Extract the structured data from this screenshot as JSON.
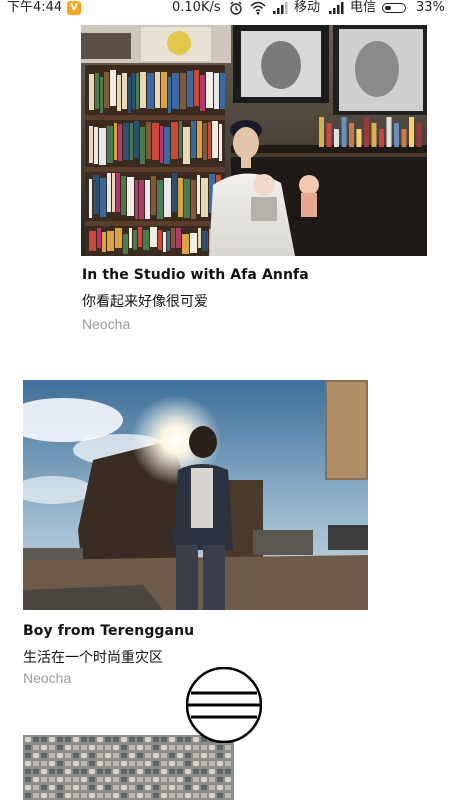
{
  "status_bar": {
    "time": "下午4:44",
    "notification_badge": "V",
    "network_speed": "0.10K/s",
    "carrier_1": "移动",
    "carrier_2": "电信",
    "battery_percent": "33%",
    "battery_level": 0.33,
    "icons": [
      "alarm-icon",
      "wifi-icon",
      "signal-icon",
      "signal-icon",
      "battery-icon"
    ]
  },
  "articles": [
    {
      "title": "In the Studio with Afa Annfa",
      "subtitle": "你看起来好像很可爱",
      "source": "Neocha",
      "image": "photo-studio-bookshelf"
    },
    {
      "title": "Boy from Terengganu",
      "subtitle": "生活在一个时尚重灾区",
      "source": "Neocha",
      "image": "photo-rooftop-sunburst"
    },
    {
      "title": "",
      "subtitle": "",
      "source": "",
      "image": "photo-apartment-blocks"
    }
  ],
  "menu": {
    "icon": "hamburger-menu-icon"
  },
  "colors": {
    "text_primary": "#111111",
    "text_secondary": "#9b9b9b",
    "background": "#ffffff",
    "badge": "#f5a623"
  }
}
